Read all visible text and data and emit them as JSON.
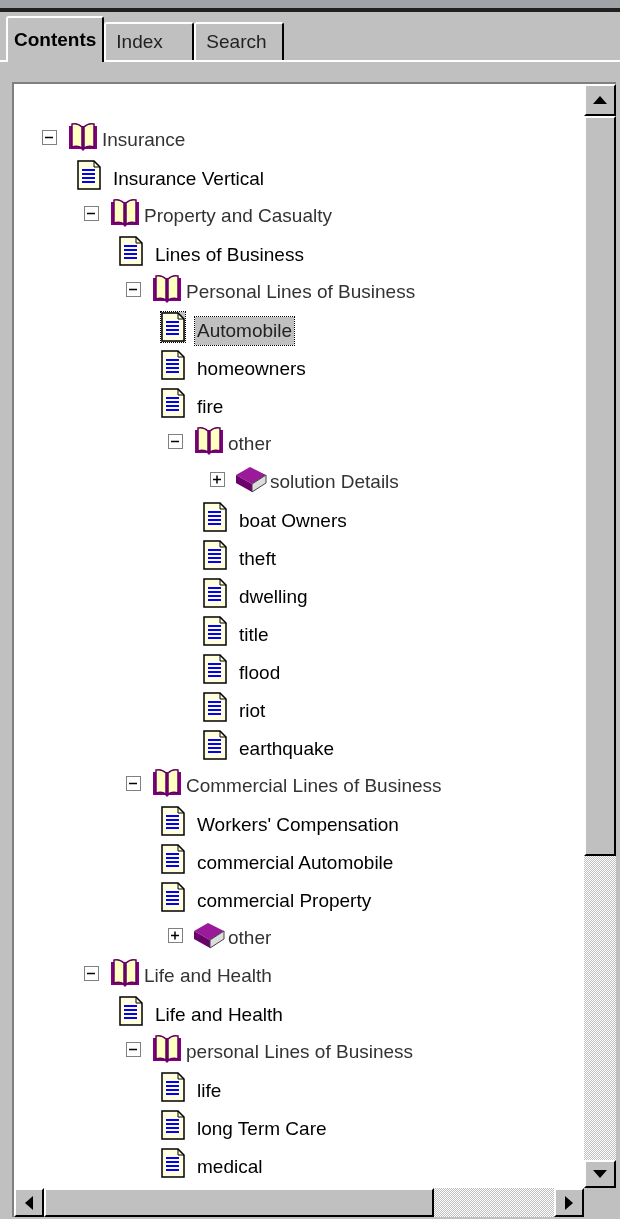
{
  "tabs": [
    {
      "label": "Contents",
      "selected": true
    },
    {
      "label": "Index",
      "selected": false
    },
    {
      "label": "Search",
      "selected": false
    }
  ],
  "tree": [
    {
      "kind": "book",
      "label": "Insurance",
      "expanded": true,
      "selected": false,
      "children": [
        {
          "kind": "page",
          "label": "Insurance Vertical",
          "selected": false
        },
        {
          "kind": "book",
          "label": "Property and Casualty",
          "expanded": true,
          "selected": false,
          "children": [
            {
              "kind": "page",
              "label": "Lines of Business",
              "selected": false
            },
            {
              "kind": "book",
              "label": "Personal Lines of Business",
              "expanded": true,
              "selected": false,
              "children": [
                {
                  "kind": "page",
                  "label": "Automobile",
                  "selected": true
                },
                {
                  "kind": "page",
                  "label": "homeowners",
                  "selected": false
                },
                {
                  "kind": "page",
                  "label": "fire",
                  "selected": false
                },
                {
                  "kind": "book",
                  "label": "other",
                  "expanded": true,
                  "selected": false,
                  "children": [
                    {
                      "kind": "book",
                      "label": "solution Details",
                      "expanded": false,
                      "selected": false
                    },
                    {
                      "kind": "page",
                      "label": "boat Owners",
                      "selected": false
                    },
                    {
                      "kind": "page",
                      "label": "theft",
                      "selected": false
                    },
                    {
                      "kind": "page",
                      "label": "dwelling",
                      "selected": false
                    },
                    {
                      "kind": "page",
                      "label": "title",
                      "selected": false
                    },
                    {
                      "kind": "page",
                      "label": "flood",
                      "selected": false
                    },
                    {
                      "kind": "page",
                      "label": "riot",
                      "selected": false
                    },
                    {
                      "kind": "page",
                      "label": "earthquake",
                      "selected": false
                    }
                  ]
                }
              ]
            },
            {
              "kind": "book",
              "label": "Commercial Lines of Business",
              "expanded": true,
              "selected": false,
              "children": [
                {
                  "kind": "page",
                  "label": "Workers' Compensation",
                  "selected": false
                },
                {
                  "kind": "page",
                  "label": "commercial Automobile",
                  "selected": false
                },
                {
                  "kind": "page",
                  "label": "commercial Property",
                  "selected": false
                },
                {
                  "kind": "book",
                  "label": "other",
                  "expanded": false,
                  "selected": false
                }
              ]
            }
          ]
        },
        {
          "kind": "book",
          "label": "Life and Health",
          "expanded": true,
          "selected": false,
          "children": [
            {
              "kind": "page",
              "label": "Life and Health",
              "selected": false
            },
            {
              "kind": "book",
              "label": "personal Lines of Business",
              "expanded": true,
              "selected": false,
              "children": [
                {
                  "kind": "page",
                  "label": "life",
                  "selected": false
                },
                {
                  "kind": "page",
                  "label": "long Term Care",
                  "selected": false
                },
                {
                  "kind": "page",
                  "label": "medical",
                  "selected": false
                }
              ]
            }
          ]
        }
      ]
    }
  ]
}
